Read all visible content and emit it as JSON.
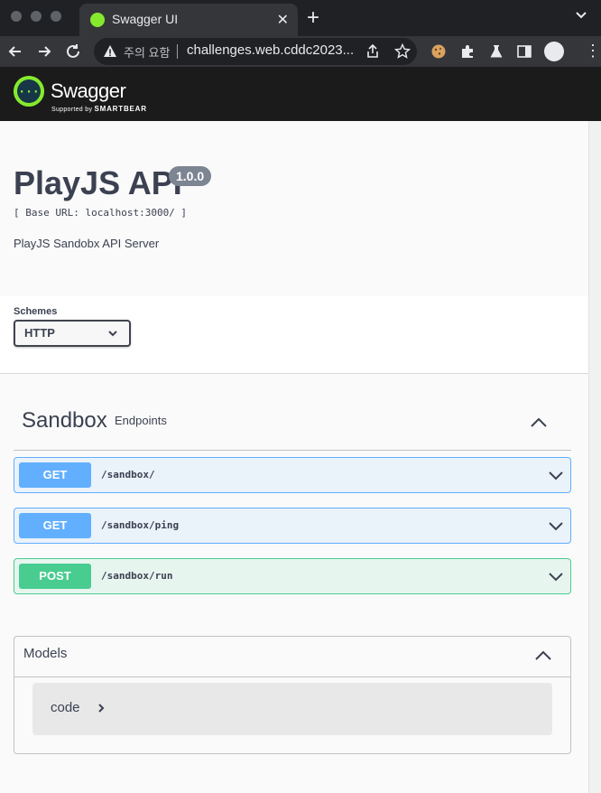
{
  "browser": {
    "tab_title": "Swagger UI",
    "tab_close": "✕",
    "new_tab": "+",
    "security_warning": "주의 요함",
    "url": "challenges.web.cddc2023...",
    "icons": [
      "back-icon",
      "forward-icon",
      "reload-icon",
      "warning-icon",
      "share-icon",
      "star-icon",
      "cookie-icon",
      "puzzle-icon",
      "flask-icon",
      "sidebar-icon",
      "profile-icon",
      "menu-icon"
    ]
  },
  "swagger": {
    "logo_text": "Swagger",
    "supported_by": "Supported by",
    "brand": "SMARTBEAR",
    "brand_color": "#85ea2d"
  },
  "info": {
    "title": "PlayJS API",
    "version": "1.0.0",
    "base_url": "[ Base URL: localhost:3000/ ]",
    "description": "PlayJS Sandobx API Server"
  },
  "schemes": {
    "label": "Schemes",
    "selected": "HTTP"
  },
  "tag": {
    "name": "Sandbox",
    "description": "Endpoints"
  },
  "operations": [
    {
      "method": "GET",
      "path": "/sandbox/",
      "color": "#61affe"
    },
    {
      "method": "GET",
      "path": "/sandbox/ping",
      "color": "#61affe"
    },
    {
      "method": "POST",
      "path": "/sandbox/run",
      "color": "#49cc90"
    }
  ],
  "models": {
    "title": "Models",
    "items": [
      {
        "name": "code"
      }
    ]
  }
}
